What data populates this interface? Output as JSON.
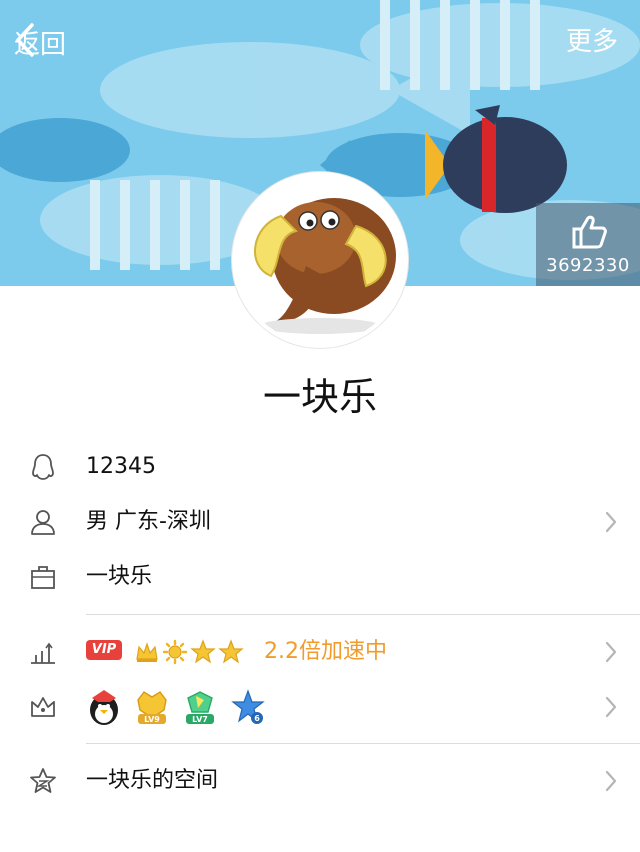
{
  "nav": {
    "back_label": "返回",
    "more_label": "更多"
  },
  "like": {
    "count": "3692330"
  },
  "profile": {
    "nickname": "一块乐",
    "qq_number": "12345",
    "gender_location": "男 广东-深圳",
    "company": "一块乐"
  },
  "vip": {
    "tag": "VIP",
    "speed_text": "2.2倍加速中"
  },
  "badges": [
    {
      "name": "qq-penguin-badge",
      "label": ""
    },
    {
      "name": "lv9-badge",
      "label": "LV9"
    },
    {
      "name": "lv7-badge",
      "label": "LV7"
    },
    {
      "name": "star-6-badge",
      "label": "6"
    }
  ],
  "space": {
    "label": "一块乐的空间"
  },
  "colors": {
    "accent_orange": "#f19b2c",
    "vip_red": "#e8403b",
    "banner_blue": "#7cc8ea"
  }
}
